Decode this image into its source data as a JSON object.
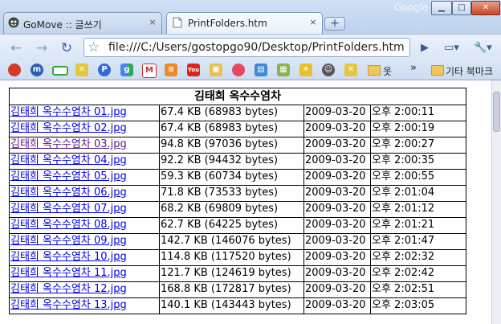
{
  "window": {
    "brand": "Google",
    "controls": {
      "minimize": "▁",
      "maximize": "□",
      "close": "✕"
    }
  },
  "tabs": [
    {
      "title": "GoMove :: 글쓰기",
      "close": "×"
    },
    {
      "title": "PrintFolders.htm",
      "close": "×"
    }
  ],
  "new_tab_label": "+",
  "toolbar": {
    "back": "←",
    "forward": "→",
    "reload": "↻",
    "star": "☆",
    "url": "file:///C:/Users/gostopgo90/Desktop/PrintFolders.htm",
    "go": "▶",
    "page_menu": "▭▾",
    "tools_menu": "🔧▾"
  },
  "bookmarks": {
    "folder1_label": "옷",
    "overflow": "»",
    "other_label": "기타 북마크"
  },
  "colors": {
    "link": "#0000ee",
    "visited_link": "#551a8b",
    "chrome_blue": "#bfd3ef"
  },
  "table": {
    "title": "김태희 옥수수염차",
    "rows": [
      {
        "name": "김태희 옥수수염차 01.jpg",
        "size": "67.4 KB (68983 bytes)",
        "date": "2009-03-20",
        "time": "오후 2:00:11",
        "visited": false
      },
      {
        "name": "김태희 옥수수염차 02.jpg",
        "size": "67.4 KB (68983 bytes)",
        "date": "2009-03-20",
        "time": "오후 2:00:19",
        "visited": false
      },
      {
        "name": "김태희 옥수수염차 03.jpg",
        "size": "94.8 KB (97036 bytes)",
        "date": "2009-03-20",
        "time": "오후 2:00:27",
        "visited": true
      },
      {
        "name": "김태희 옥수수염차 04.jpg",
        "size": "92.2 KB (94432 bytes)",
        "date": "2009-03-20",
        "time": "오후 2:00:35",
        "visited": false
      },
      {
        "name": "김태희 옥수수염차 05.jpg",
        "size": "59.3 KB (60734 bytes)",
        "date": "2009-03-20",
        "time": "오후 2:00:55",
        "visited": false
      },
      {
        "name": "김태희 옥수수염차 06.jpg",
        "size": "71.8 KB (73533 bytes)",
        "date": "2009-03-20",
        "time": "오후 2:01:04",
        "visited": false
      },
      {
        "name": "김태희 옥수수염차 07.jpg",
        "size": "68.2 KB (69809 bytes)",
        "date": "2009-03-20",
        "time": "오후 2:01:12",
        "visited": false
      },
      {
        "name": "김태희 옥수수염차 08.jpg",
        "size": "62.7 KB (64225 bytes)",
        "date": "2009-03-20",
        "time": "오후 2:01:21",
        "visited": false
      },
      {
        "name": "김태희 옥수수염차 09.jpg",
        "size": "142.7 KB (146076 bytes)",
        "date": "2009-03-20",
        "time": "오후 2:01:47",
        "visited": false
      },
      {
        "name": "김태희 옥수수염차 10.jpg",
        "size": "114.8 KB (117520 bytes)",
        "date": "2009-03-20",
        "time": "오후 2:02:32",
        "visited": false
      },
      {
        "name": "김태희 옥수수염차 11.jpg",
        "size": "121.7 KB (124619 bytes)",
        "date": "2009-03-20",
        "time": "오후 2:02:42",
        "visited": false
      },
      {
        "name": "김태희 옥수수염차 12.jpg",
        "size": "168.8 KB (172817 bytes)",
        "date": "2009-03-20",
        "time": "오후 2:02:51",
        "visited": false
      },
      {
        "name": "김태희 옥수수염차 13.jpg",
        "size": "140.1 KB (143443 bytes)",
        "date": "2009-03-20",
        "time": "오후 2:03:05",
        "visited": false
      }
    ]
  }
}
